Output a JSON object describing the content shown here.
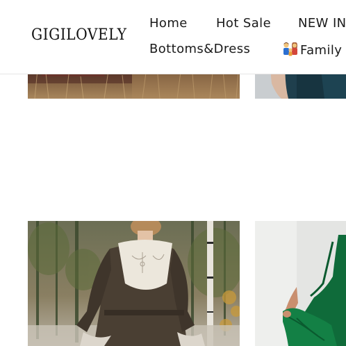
{
  "header": {
    "logo_text": "GIGILOVELY",
    "nav": {
      "home": "Home",
      "hot_sale": "Hot Sale",
      "new_in": "NEW IN",
      "bottoms_dress": "Bottoms&Dress",
      "family": "Family"
    },
    "family_icon": "family-emoji-icon"
  },
  "colors": {
    "text": "#1a1a1a",
    "header_border": "#e6e6e6",
    "dress_green": "#0f6b3a",
    "dress_brown": "#4a3f33"
  },
  "products": [
    {
      "image": "autumn-field-photo"
    },
    {
      "image": "dark-teal-dress-photo"
    },
    {
      "image": "brown-linen-dress-with-embroidered-collar-photo"
    },
    {
      "image": "green-dress-photo"
    }
  ]
}
